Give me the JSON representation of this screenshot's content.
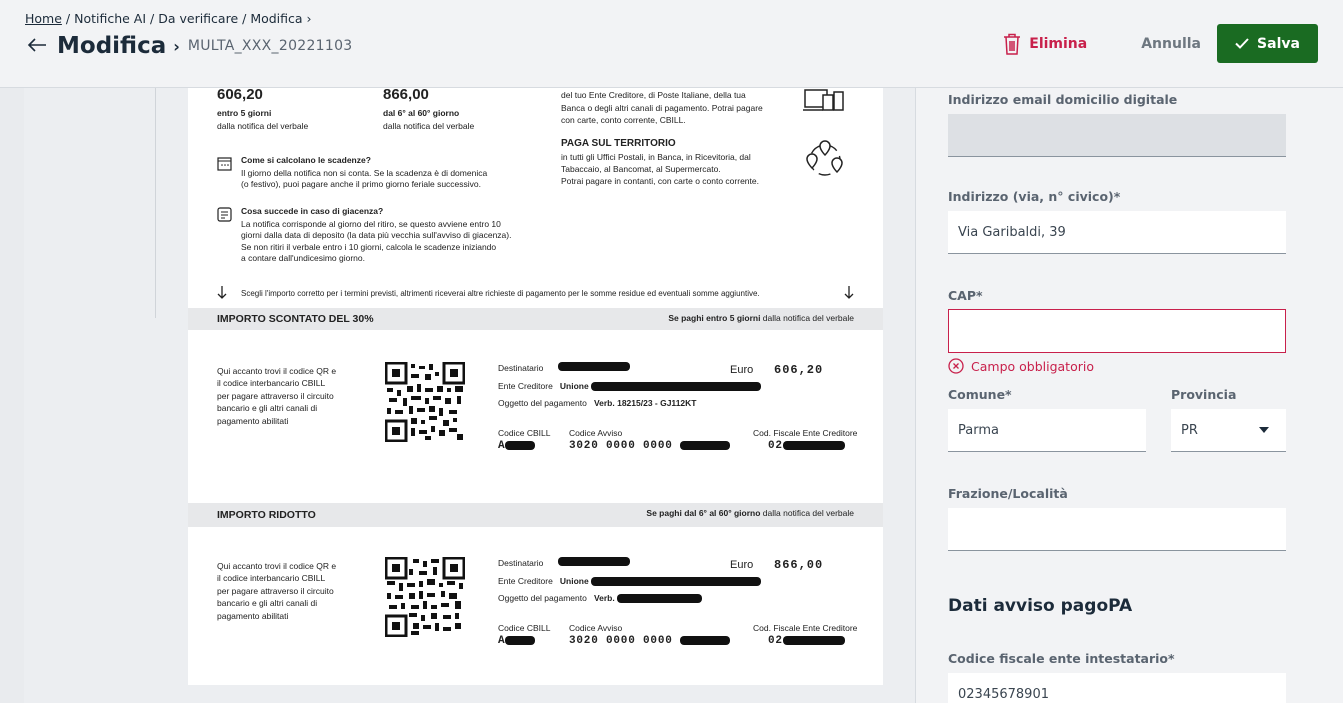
{
  "header": {
    "breadcrumb": {
      "home": "Home",
      "sep1": " / ",
      "notifiche": "Notifiche AI",
      "sep2": " / ",
      "da_verificare": "Da verificare",
      "sep3": " / ",
      "modifica": "Modifica",
      "sep4": " ›"
    },
    "back_icon": "arrow-left-icon",
    "title": "Modifica",
    "title_separator": "›",
    "filename": "MULTA_XXX_20221103",
    "delete_label": "Elimina",
    "cancel_label": "Annulla",
    "save_label": "Salva"
  },
  "document": {
    "top_amounts": [
      {
        "amount": "606,20",
        "when": "entro 5 giorni",
        "from": "dalla notifica del verbale"
      },
      {
        "amount": "866,00",
        "when": "dal 6° al 60° giorno",
        "from": "dalla notifica del verbale"
      }
    ],
    "online_lines": [
      "del tuo Ente Creditore, di Poste Italiane, della tua",
      "Banca o degli altri canali di pagamento. Potrai pagare",
      "con carte, conto corrente, CBILL."
    ],
    "territorio_title": "PAGA SUL TERRITORIO",
    "territorio_lines": [
      "in tutti gli Uffici Postali, in Banca, in Ricevitoria, dal",
      "Tabaccaio, al Bancomat, al Supermercato.",
      "Potrai pagare in contanti, con carte o conto corrente."
    ],
    "scadenze_title": "Come si calcolano le scadenze?",
    "scadenze_lines": [
      "Il giorno della notifica non si conta. Se la scadenza è di domenica",
      "(o festivo), puoi pagare anche il primo giorno feriale successivo."
    ],
    "giacenza_title": "Cosa succede in caso di giacenza?",
    "giacenza_lines": [
      "La notifica corrisponde al giorno del ritiro, se questo avviene entro 10",
      "giorni dalla data di deposito (la data più vecchia sull'avviso di giacenza).",
      "Se non ritiri il verbale entro i 10 giorni, calcola le scadenze iniziando",
      "a contare dall'undicesimo giorno."
    ],
    "choose_note": "Scegli l'importo corretto per i termini previsti, altrimenti riceverai altre richieste di pagamento per le somme residue ed eventuali somme aggiuntive.",
    "sections": [
      {
        "band_title": "IMPORTO SCONTATO DEL 30%",
        "band_right_bold": "Se paghi entro 5 giorni",
        "band_right_rest": " dalla notifica del verbale",
        "info_lines": [
          "Qui accanto trovi il codice QR e",
          "il codice interbancario CBILL",
          "per pagare attraverso il circuito",
          "bancario e gli altri canali di",
          "pagamento abilitati"
        ],
        "destinatario_label": "Destinatario",
        "ente_label": "Ente Creditore",
        "ente_value": "Unione",
        "oggetto_label": "Oggetto del pagamento",
        "oggetto_value": "Verb. 18215/23 - GJ112KT",
        "euro_label": "Euro",
        "euro_value": "606,20",
        "cbill_label": "Codice CBILL",
        "cbill_value": "A",
        "avviso_label": "Codice Avviso",
        "avviso_value": "3020 0000 0000",
        "cf_label": "Cod. Fiscale Ente Creditore",
        "cf_value": "02"
      },
      {
        "band_title": "IMPORTO RIDOTTO",
        "band_right_bold": "Se paghi dal 6° al 60° giorno",
        "band_right_rest": " dalla notifica del verbale",
        "info_lines": [
          "Qui accanto trovi il codice QR e",
          "il codice interbancario CBILL",
          "per pagare attraverso il circuito",
          "bancario e gli altri canali di",
          "pagamento abilitati"
        ],
        "destinatario_label": "Destinatario",
        "ente_label": "Ente Creditore",
        "ente_value": "Unione",
        "oggetto_label": "Oggetto del pagamento",
        "oggetto_value": "Verb.",
        "euro_label": "Euro",
        "euro_value": "866,00",
        "cbill_label": "Codice CBILL",
        "cbill_value": "A",
        "avviso_label": "Codice Avviso",
        "avviso_value": "3020 0000 0000",
        "cf_label": "Cod. Fiscale Ente Creditore",
        "cf_value": "02"
      }
    ]
  },
  "form": {
    "email_label": "Indirizzo email domicilio digitale",
    "email_value": "",
    "address_label": "Indirizzo (via, n° civico)*",
    "address_value": "Via Garibaldi, 39",
    "cap_label": "CAP*",
    "cap_value": "",
    "cap_error": "Campo obbligatorio",
    "comune_label": "Comune*",
    "comune_value": "Parma",
    "provincia_label": "Provincia",
    "provincia_value": "PR",
    "frazione_label": "Frazione/Località",
    "frazione_value": "",
    "section_title": "Dati avviso pagoPA",
    "cf_label": "Codice fiscale ente intestatario*",
    "cf_value": "02345678901"
  },
  "colors": {
    "primary_green": "#1a6b22",
    "danger_red": "#c8204b",
    "text_dark": "#1c2b3a"
  }
}
